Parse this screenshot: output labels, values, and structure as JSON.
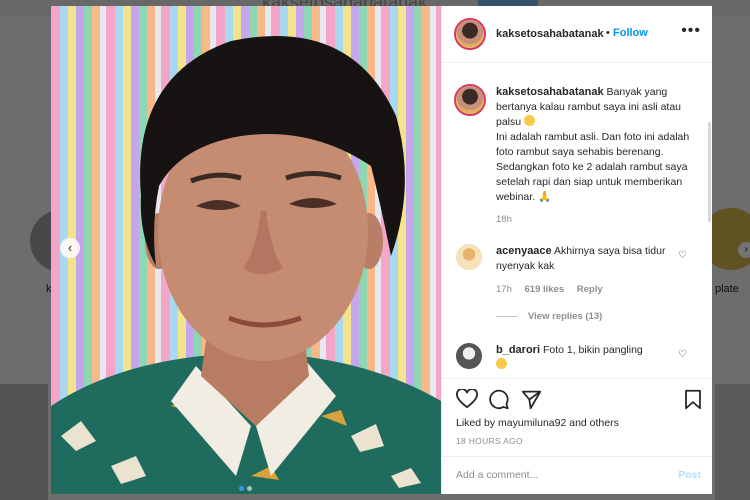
{
  "post": {
    "username": "kaksetosahabatanak",
    "follow_label": "Follow",
    "separator": "•",
    "more_label": "•••",
    "caption": {
      "username": "kaksetosahabatanak",
      "line1": "Banyak yang bertanya kalau rambut saya ini asli atau palsu",
      "line2": "Ini adalah rambut asli. Dan foto ini adalah foto rambut saya sehabis berenang. Sedangkan foto ke 2 adalah rambut saya setelah rapi dan siap untuk memberikan webinar.",
      "emoji2": "🙏",
      "time": "18h"
    },
    "comments": [
      {
        "username": "acenyaace",
        "text": "Akhirnya saya bisa tidur nyenyak kak",
        "time": "17h",
        "likes": "619 likes",
        "reply_label": "Reply",
        "view_replies": "View replies (13)"
      },
      {
        "username": "b_darori",
        "text": "Foto 1, bikin pangling"
      }
    ],
    "liked_by": "Liked by mayumiluna92 and others",
    "timestamp": "18 HOURS AGO",
    "comment_placeholder": "Add a comment...",
    "post_label": "Post"
  },
  "background": {
    "profile_name": "kaksetosahabatanak",
    "story_label_right": "plate",
    "story_label_left": "k"
  },
  "icons": [
    "chevron-left-icon",
    "heart-icon",
    "comment-icon",
    "share-icon",
    "bookmark-icon",
    "more-icon"
  ],
  "colors": {
    "accent": "#0095f6",
    "story_ring": "#d8385c",
    "overlay": "rgba(0,0,0,0.55)"
  }
}
